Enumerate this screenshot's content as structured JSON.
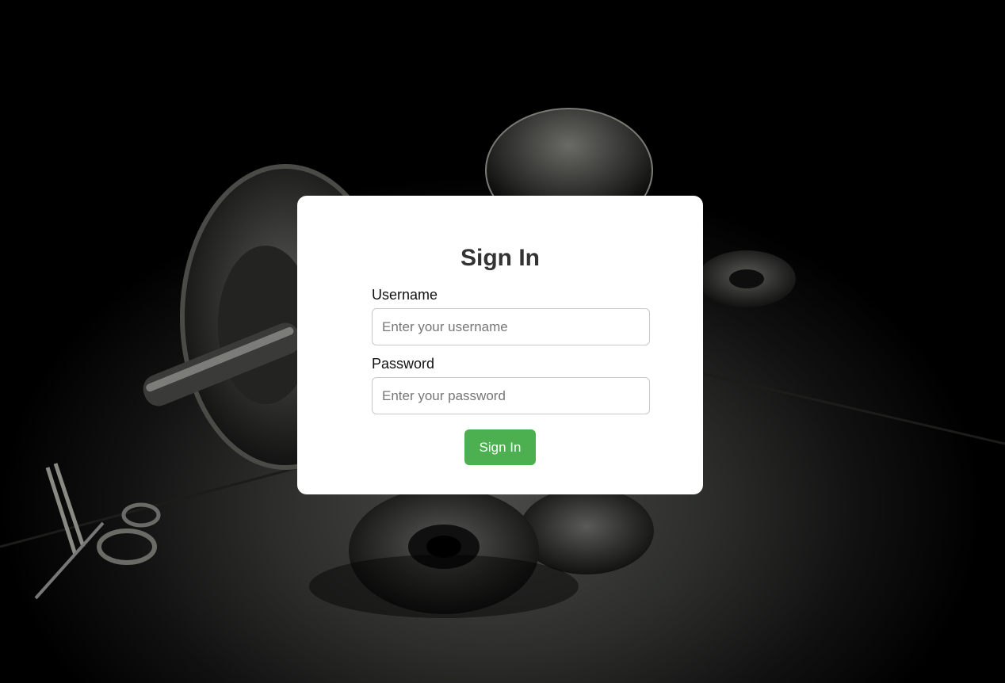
{
  "login": {
    "title": "Sign In",
    "username": {
      "label": "Username",
      "placeholder": "Enter your username",
      "value": ""
    },
    "password": {
      "label": "Password",
      "placeholder": "Enter your password",
      "value": ""
    },
    "submit_label": "Sign In"
  },
  "colors": {
    "card_background": "#ffffff",
    "title_text": "#333333",
    "button_background": "#4caf50",
    "button_text": "#ffffff"
  },
  "background": {
    "description_icon": "barbell-weights-image"
  }
}
